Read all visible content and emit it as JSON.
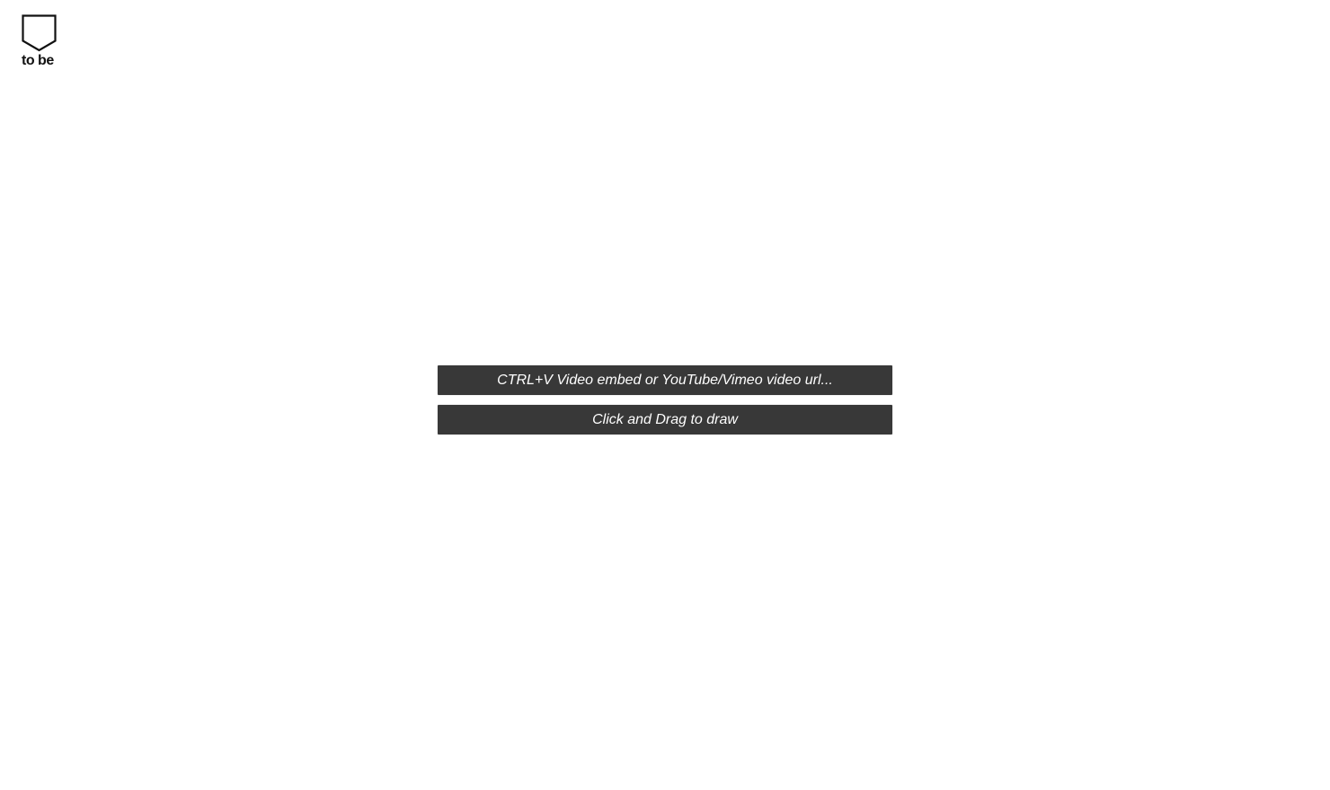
{
  "logo": {
    "text": "to be",
    "icon": "shield-outline-icon"
  },
  "hints": {
    "paste": "CTRL+V Video embed or YouTube/Vimeo video url...",
    "draw": "Click and Drag to draw"
  },
  "colors": {
    "background": "#ffffff",
    "hint_bar": "#383838",
    "hint_text": "#ffffff",
    "logo": "#111111"
  }
}
